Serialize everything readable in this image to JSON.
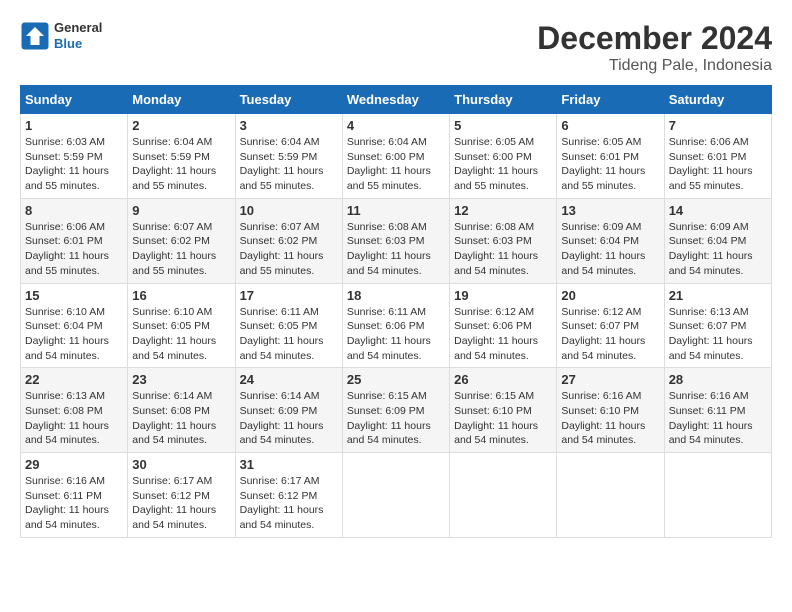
{
  "header": {
    "logo_line1": "General",
    "logo_line2": "Blue",
    "title": "December 2024",
    "subtitle": "Tideng Pale, Indonesia"
  },
  "calendar": {
    "days_of_week": [
      "Sunday",
      "Monday",
      "Tuesday",
      "Wednesday",
      "Thursday",
      "Friday",
      "Saturday"
    ],
    "weeks": [
      [
        {
          "day": 1,
          "info": "Sunrise: 6:03 AM\nSunset: 5:59 PM\nDaylight: 11 hours\nand 55 minutes."
        },
        {
          "day": 2,
          "info": "Sunrise: 6:04 AM\nSunset: 5:59 PM\nDaylight: 11 hours\nand 55 minutes."
        },
        {
          "day": 3,
          "info": "Sunrise: 6:04 AM\nSunset: 5:59 PM\nDaylight: 11 hours\nand 55 minutes."
        },
        {
          "day": 4,
          "info": "Sunrise: 6:04 AM\nSunset: 6:00 PM\nDaylight: 11 hours\nand 55 minutes."
        },
        {
          "day": 5,
          "info": "Sunrise: 6:05 AM\nSunset: 6:00 PM\nDaylight: 11 hours\nand 55 minutes."
        },
        {
          "day": 6,
          "info": "Sunrise: 6:05 AM\nSunset: 6:01 PM\nDaylight: 11 hours\nand 55 minutes."
        },
        {
          "day": 7,
          "info": "Sunrise: 6:06 AM\nSunset: 6:01 PM\nDaylight: 11 hours\nand 55 minutes."
        }
      ],
      [
        {
          "day": 8,
          "info": "Sunrise: 6:06 AM\nSunset: 6:01 PM\nDaylight: 11 hours\nand 55 minutes."
        },
        {
          "day": 9,
          "info": "Sunrise: 6:07 AM\nSunset: 6:02 PM\nDaylight: 11 hours\nand 55 minutes."
        },
        {
          "day": 10,
          "info": "Sunrise: 6:07 AM\nSunset: 6:02 PM\nDaylight: 11 hours\nand 55 minutes."
        },
        {
          "day": 11,
          "info": "Sunrise: 6:08 AM\nSunset: 6:03 PM\nDaylight: 11 hours\nand 54 minutes."
        },
        {
          "day": 12,
          "info": "Sunrise: 6:08 AM\nSunset: 6:03 PM\nDaylight: 11 hours\nand 54 minutes."
        },
        {
          "day": 13,
          "info": "Sunrise: 6:09 AM\nSunset: 6:04 PM\nDaylight: 11 hours\nand 54 minutes."
        },
        {
          "day": 14,
          "info": "Sunrise: 6:09 AM\nSunset: 6:04 PM\nDaylight: 11 hours\nand 54 minutes."
        }
      ],
      [
        {
          "day": 15,
          "info": "Sunrise: 6:10 AM\nSunset: 6:04 PM\nDaylight: 11 hours\nand 54 minutes."
        },
        {
          "day": 16,
          "info": "Sunrise: 6:10 AM\nSunset: 6:05 PM\nDaylight: 11 hours\nand 54 minutes."
        },
        {
          "day": 17,
          "info": "Sunrise: 6:11 AM\nSunset: 6:05 PM\nDaylight: 11 hours\nand 54 minutes."
        },
        {
          "day": 18,
          "info": "Sunrise: 6:11 AM\nSunset: 6:06 PM\nDaylight: 11 hours\nand 54 minutes."
        },
        {
          "day": 19,
          "info": "Sunrise: 6:12 AM\nSunset: 6:06 PM\nDaylight: 11 hours\nand 54 minutes."
        },
        {
          "day": 20,
          "info": "Sunrise: 6:12 AM\nSunset: 6:07 PM\nDaylight: 11 hours\nand 54 minutes."
        },
        {
          "day": 21,
          "info": "Sunrise: 6:13 AM\nSunset: 6:07 PM\nDaylight: 11 hours\nand 54 minutes."
        }
      ],
      [
        {
          "day": 22,
          "info": "Sunrise: 6:13 AM\nSunset: 6:08 PM\nDaylight: 11 hours\nand 54 minutes."
        },
        {
          "day": 23,
          "info": "Sunrise: 6:14 AM\nSunset: 6:08 PM\nDaylight: 11 hours\nand 54 minutes."
        },
        {
          "day": 24,
          "info": "Sunrise: 6:14 AM\nSunset: 6:09 PM\nDaylight: 11 hours\nand 54 minutes."
        },
        {
          "day": 25,
          "info": "Sunrise: 6:15 AM\nSunset: 6:09 PM\nDaylight: 11 hours\nand 54 minutes."
        },
        {
          "day": 26,
          "info": "Sunrise: 6:15 AM\nSunset: 6:10 PM\nDaylight: 11 hours\nand 54 minutes."
        },
        {
          "day": 27,
          "info": "Sunrise: 6:16 AM\nSunset: 6:10 PM\nDaylight: 11 hours\nand 54 minutes."
        },
        {
          "day": 28,
          "info": "Sunrise: 6:16 AM\nSunset: 6:11 PM\nDaylight: 11 hours\nand 54 minutes."
        }
      ],
      [
        {
          "day": 29,
          "info": "Sunrise: 6:16 AM\nSunset: 6:11 PM\nDaylight: 11 hours\nand 54 minutes."
        },
        {
          "day": 30,
          "info": "Sunrise: 6:17 AM\nSunset: 6:12 PM\nDaylight: 11 hours\nand 54 minutes."
        },
        {
          "day": 31,
          "info": "Sunrise: 6:17 AM\nSunset: 6:12 PM\nDaylight: 11 hours\nand 54 minutes."
        },
        null,
        null,
        null,
        null
      ]
    ]
  }
}
